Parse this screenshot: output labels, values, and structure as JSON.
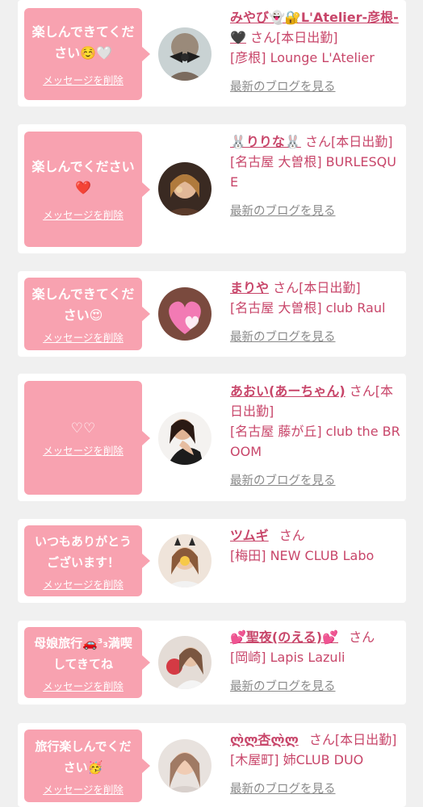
{
  "delete_label": "メッセージを削除",
  "blog_label": "最新のブログを見る",
  "colors": {
    "bubble": "#f8a2b0",
    "name": "#c8466a",
    "background": "#f0f0f0"
  },
  "cards": [
    {
      "message": "楽しんできてください☺️🤍",
      "name": "みやび👻🔐L'Atelier-彦根-🖤",
      "status": "さん[本日出勤]",
      "shop": "[彦根] Lounge L'Atelier",
      "has_blog": true
    },
    {
      "message": "楽しんでください❤️",
      "name": "🐰りりな🐰",
      "status": "さん[本日出勤]",
      "shop": "[名古屋 大曽根] BURLESQUE",
      "has_blog": true
    },
    {
      "message": "楽しんできてください😍",
      "name": "まりや",
      "status": "さん[本日出勤]",
      "shop": "[名古屋 大曽根] club Raul",
      "has_blog": true
    },
    {
      "message": "♡♡",
      "name": "あおい(あーちゃん)",
      "status": "さん[本日出勤]",
      "shop": "[名古屋 藤が丘] club the BROOM",
      "has_blog": true
    },
    {
      "message": "いつもありがとうございます！",
      "name": "ツムギ",
      "status": "さん",
      "shop": "[梅田] NEW CLUB Labo",
      "has_blog": false
    },
    {
      "message": "母娘旅行🚗³₃満喫してきてね",
      "name": "💕聖夜(のえる)💕",
      "status": "さん",
      "shop": "[岡崎] Lapis Lazuli",
      "has_blog": true
    },
    {
      "message": "旅行楽しんでください🥳",
      "name": "ლ̀ლ杏ლ̀ლ",
      "status": "さん[本日出勤]",
      "shop": "[木屋町] 姉CLUB DUO",
      "has_blog": true
    }
  ]
}
